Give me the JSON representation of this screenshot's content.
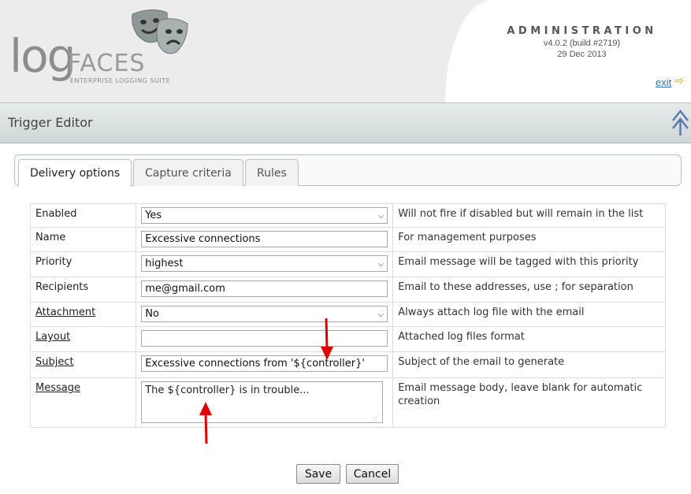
{
  "header": {
    "logo_log": "log",
    "logo_faces": "FACES",
    "logo_tagline": "ENTERPRISE LOGGING SUITE",
    "admin_title": "ADMINISTRATION",
    "version": "v4.0.2 (build #2719)",
    "date": "29 Dec 2013",
    "exit_label": "exit"
  },
  "titlebar": {
    "title": "Trigger Editor"
  },
  "tabs": [
    {
      "label": "Delivery options",
      "active": true
    },
    {
      "label": "Capture criteria",
      "active": false
    },
    {
      "label": "Rules",
      "active": false
    }
  ],
  "form": {
    "enabled": {
      "label": "Enabled",
      "value": "Yes",
      "description": "Will not fire if disabled but will remain in the list"
    },
    "name": {
      "label": "Name",
      "value": "Excessive connections",
      "description": "For management purposes"
    },
    "priority": {
      "label": "Priority",
      "value": "highest",
      "description": "Email message will be tagged with this priority"
    },
    "recipients": {
      "label": "Recipients",
      "value": "me@gmail.com",
      "description": "Email to these addresses, use ; for separation"
    },
    "attachment": {
      "label": "Attachment",
      "value": "No",
      "description": "Always attach log file with the email"
    },
    "layout": {
      "label": "Layout",
      "value": "",
      "description": "Attached log files format"
    },
    "subject": {
      "label": "Subject",
      "value": "Excessive connections from '${controller}'",
      "description": "Subject of the email to generate"
    },
    "message": {
      "label": "Message",
      "value": "The ${controller} is in trouble...",
      "description": "Email message body, leave blank for automatic creation"
    }
  },
  "buttons": {
    "save_label": "Save",
    "cancel_label": "Cancel"
  },
  "colors": {
    "accent_link": "#3a6fb0",
    "annotation_arrow": "#e00000",
    "titlebar": "#d8dfdf"
  }
}
